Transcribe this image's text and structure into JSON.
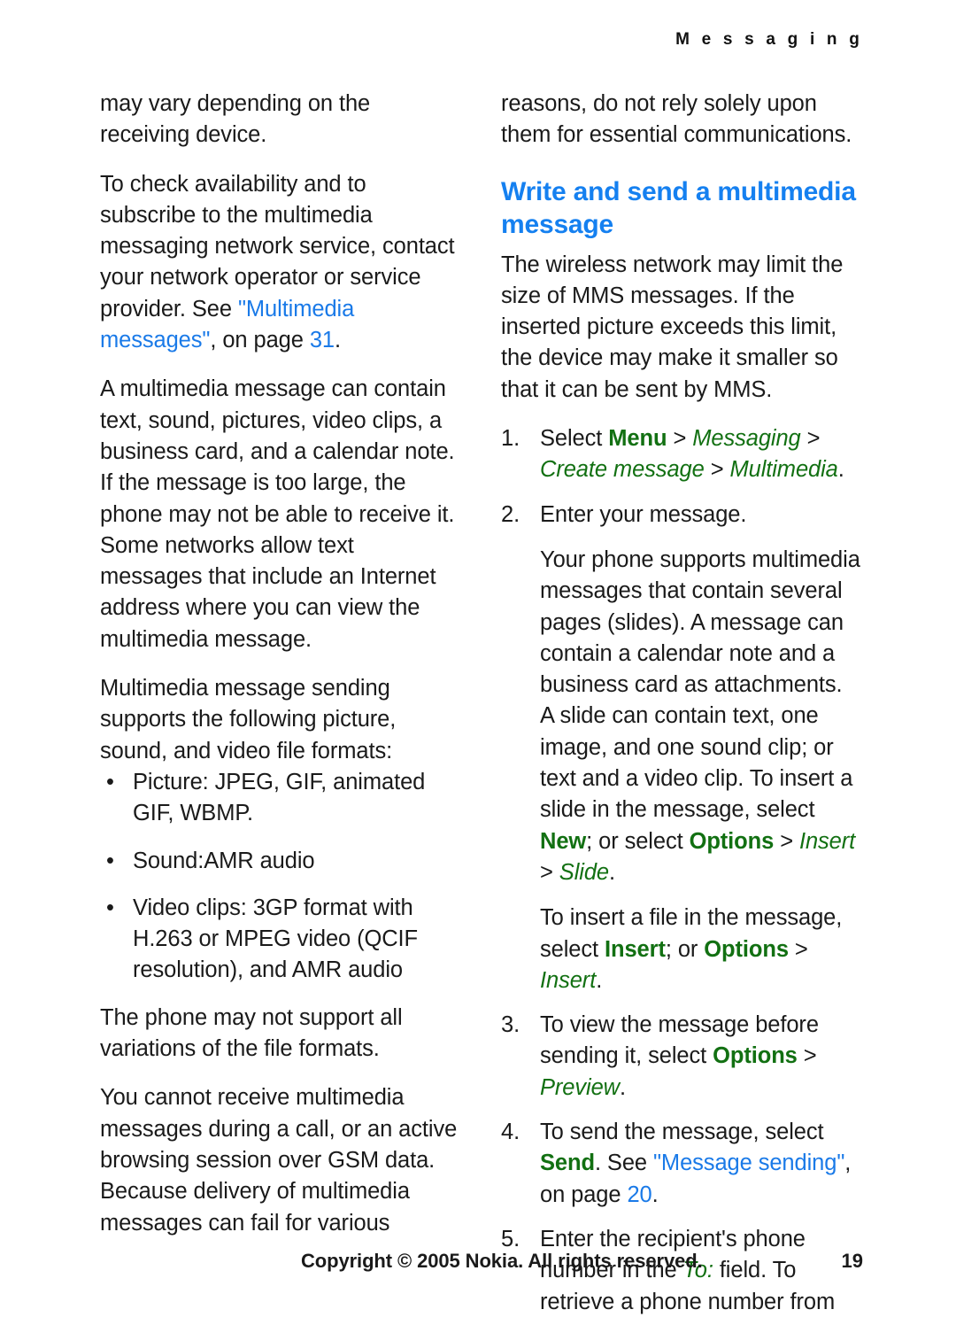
{
  "header": {
    "chapter": "M e s s a g i n g"
  },
  "colors": {
    "link": "#1a7ae8",
    "heading": "#1580f0",
    "ui_reference": "#127012",
    "body_text": "#1a1a1a"
  },
  "left_column": {
    "paragraphs": [
      {
        "id": "p-receiving-device",
        "runs": [
          {
            "text": "may vary depending on the receiving device.",
            "style": "plain"
          }
        ]
      },
      {
        "id": "p-check-availability",
        "runs": [
          {
            "text": "To check availability and to subscribe to the multimedia messaging network service, contact your network operator or service provider. See ",
            "style": "plain"
          },
          {
            "text": "\"Multimedia messages\"",
            "style": "link"
          },
          {
            "text": ", on page ",
            "style": "plain"
          },
          {
            "text": "31",
            "style": "link"
          },
          {
            "text": ".",
            "style": "plain"
          }
        ]
      },
      {
        "id": "p-mms-can-contain",
        "runs": [
          {
            "text": "A multimedia message can contain text, sound, pictures, video clips, a business card, and a calendar note. If the message is too large, the phone may not be able to receive it. Some networks allow text messages that include an Internet address where you can view the multimedia message.",
            "style": "plain"
          }
        ]
      },
      {
        "id": "p-sending-supports",
        "runs": [
          {
            "text": "Multimedia message sending supports the following picture, sound, and video file formats:",
            "style": "plain"
          }
        ]
      }
    ],
    "bullets": {
      "glyph": "•",
      "items": [
        {
          "id": "bullet-picture",
          "text": "Picture: JPEG, GIF, animated GIF, WBMP."
        },
        {
          "id": "bullet-sound",
          "text": "Sound:AMR audio"
        },
        {
          "id": "bullet-video",
          "text": "Video clips: 3GP format with H.263 or MPEG video (QCIF resolution), and AMR audio"
        }
      ]
    },
    "paragraphs_after": [
      {
        "id": "p-not-support-all",
        "runs": [
          {
            "text": "The phone may not support all variations of the file formats.",
            "style": "plain"
          }
        ]
      },
      {
        "id": "p-cannot-receive",
        "runs": [
          {
            "text": "You cannot receive multimedia messages during a call, or an active browsing session over GSM data. Because delivery of multimedia messages can fail for various",
            "style": "plain"
          }
        ]
      }
    ]
  },
  "right_column": {
    "paragraph_top": {
      "id": "p-reasons-continued",
      "runs": [
        {
          "text": "reasons, do not rely solely upon them for essential communications.",
          "style": "plain"
        }
      ]
    },
    "heading": "Write and send a multimedia message",
    "paragraph_intro": {
      "id": "p-wireless-limit",
      "runs": [
        {
          "text": "The wireless network may limit the size of MMS messages. If the inserted picture exceeds this limit, the device may make it smaller so that it can be sent by MMS.",
          "style": "plain"
        }
      ]
    },
    "steps": [
      {
        "id": "step-1",
        "number": "1.",
        "runs": [
          {
            "text": "Select ",
            "style": "plain"
          },
          {
            "text": "Menu",
            "style": "ui-bold"
          },
          {
            "text": " > ",
            "style": "sep"
          },
          {
            "text": "Messaging",
            "style": "ui-italic"
          },
          {
            "text": " > ",
            "style": "sep"
          },
          {
            "text": "Create message",
            "style": "ui-italic"
          },
          {
            "text": " > ",
            "style": "sep"
          },
          {
            "text": "Multimedia",
            "style": "ui-italic"
          },
          {
            "text": ".",
            "style": "plain"
          }
        ],
        "sub_paragraphs": []
      },
      {
        "id": "step-2",
        "number": "2.",
        "runs": [
          {
            "text": "Enter your message.",
            "style": "plain"
          }
        ],
        "sub_paragraphs": [
          {
            "id": "step-2-sub-1",
            "runs": [
              {
                "text": "Your phone supports multimedia messages that contain several pages (slides). A message can contain a calendar note and a business card as attachments. A slide can contain text, one image, and one sound clip; or text and a video clip. To insert a slide in the message, select ",
                "style": "plain"
              },
              {
                "text": "New",
                "style": "ui-bold"
              },
              {
                "text": "; or select ",
                "style": "plain"
              },
              {
                "text": "Options",
                "style": "ui-bold"
              },
              {
                "text": " > ",
                "style": "sep"
              },
              {
                "text": "Insert",
                "style": "ui-italic"
              },
              {
                "text": " > ",
                "style": "sep"
              },
              {
                "text": "Slide",
                "style": "ui-italic"
              },
              {
                "text": ".",
                "style": "plain"
              }
            ]
          },
          {
            "id": "step-2-sub-2",
            "runs": [
              {
                "text": "To insert a file in the message, select ",
                "style": "plain"
              },
              {
                "text": "Insert",
                "style": "ui-bold"
              },
              {
                "text": "; or ",
                "style": "plain"
              },
              {
                "text": "Options",
                "style": "ui-bold"
              },
              {
                "text": " > ",
                "style": "sep"
              },
              {
                "text": "Insert",
                "style": "ui-italic"
              },
              {
                "text": ".",
                "style": "plain"
              }
            ]
          }
        ]
      },
      {
        "id": "step-3",
        "number": "3.",
        "runs": [
          {
            "text": "To view the message before sending it, select ",
            "style": "plain"
          },
          {
            "text": "Options",
            "style": "ui-bold"
          },
          {
            "text": " > ",
            "style": "sep"
          },
          {
            "text": "Preview",
            "style": "ui-italic"
          },
          {
            "text": ".",
            "style": "plain"
          }
        ],
        "sub_paragraphs": []
      },
      {
        "id": "step-4",
        "number": "4.",
        "runs": [
          {
            "text": "To send the message, select ",
            "style": "plain"
          },
          {
            "text": "Send",
            "style": "ui-bold"
          },
          {
            "text": ". See ",
            "style": "plain"
          },
          {
            "text": "\"Message sending\"",
            "style": "link"
          },
          {
            "text": ", on page ",
            "style": "plain"
          },
          {
            "text": "20",
            "style": "link"
          },
          {
            "text": ".",
            "style": "plain"
          }
        ],
        "sub_paragraphs": []
      },
      {
        "id": "step-5",
        "number": "5.",
        "runs": [
          {
            "text": "Enter the recipient's phone number in the ",
            "style": "plain"
          },
          {
            "text": "To:",
            "style": "ui-italic"
          },
          {
            "text": " field. To retrieve a phone number from",
            "style": "plain"
          }
        ],
        "sub_paragraphs": []
      }
    ]
  },
  "footer": {
    "copyright": "Copyright © 2005 Nokia. All rights reserved.",
    "page_number": "19"
  }
}
